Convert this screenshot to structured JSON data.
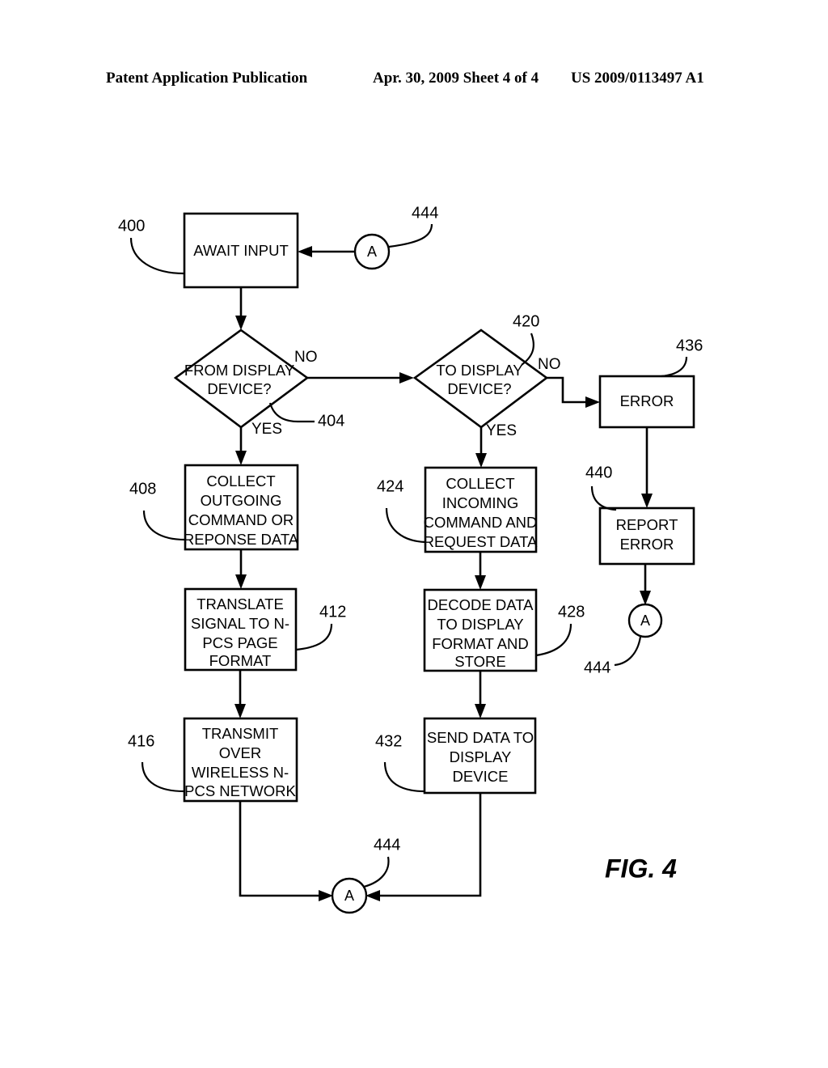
{
  "header": {
    "left": "Patent Application Publication",
    "middle": "Apr. 30, 2009  Sheet 4 of 4",
    "right": "US 2009/0113497 A1"
  },
  "figure": {
    "label": "FIG. 4",
    "connector_letter": "A"
  },
  "nodes": {
    "await_input": {
      "ref": "400",
      "lines": [
        "AWAIT INPUT"
      ]
    },
    "from_display_device": {
      "ref": "404",
      "lines": [
        "FROM DISPLAY",
        "DEVICE?"
      ]
    },
    "to_display_device": {
      "ref": "420",
      "lines": [
        "TO DISPLAY",
        "DEVICE?"
      ]
    },
    "error": {
      "ref": "436",
      "lines": [
        "ERROR"
      ]
    },
    "collect_outgoing": {
      "ref": "408",
      "lines": [
        "COLLECT",
        "OUTGOING",
        "COMMAND OR",
        "REPONSE DATA"
      ]
    },
    "collect_incoming": {
      "ref": "424",
      "lines": [
        "COLLECT",
        "INCOMING",
        "COMMAND AND",
        "REQUEST DATA"
      ]
    },
    "report_error": {
      "ref": "440",
      "lines": [
        "REPORT",
        "ERROR"
      ]
    },
    "translate_signal": {
      "ref": "412",
      "lines": [
        "TRANSLATE",
        "SIGNAL TO N-",
        "PCS PAGE",
        "FORMAT"
      ]
    },
    "decode_data": {
      "ref": "428",
      "lines": [
        "DECODE DATA",
        "TO DISPLAY",
        "FORMAT AND",
        "STORE"
      ]
    },
    "transmit_over": {
      "ref": "416",
      "lines": [
        "TRANSMIT",
        "OVER",
        "WIRELESS N-",
        "PCS NETWORK"
      ]
    },
    "send_data": {
      "ref": "432",
      "lines": [
        "SEND DATA TO",
        "DISPLAY",
        "DEVICE"
      ]
    }
  },
  "connectors": {
    "top_right": {
      "ref": "444",
      "letter": "A"
    },
    "mid_right": {
      "ref": "444",
      "letter": "A"
    },
    "bottom": {
      "ref": "444",
      "letter": "A"
    }
  },
  "branch_labels": {
    "from_display_no": "NO",
    "from_display_yes": "YES",
    "to_display_no": "NO",
    "to_display_yes": "YES"
  },
  "colors": {
    "ink": "#000000",
    "paper": "#ffffff"
  }
}
